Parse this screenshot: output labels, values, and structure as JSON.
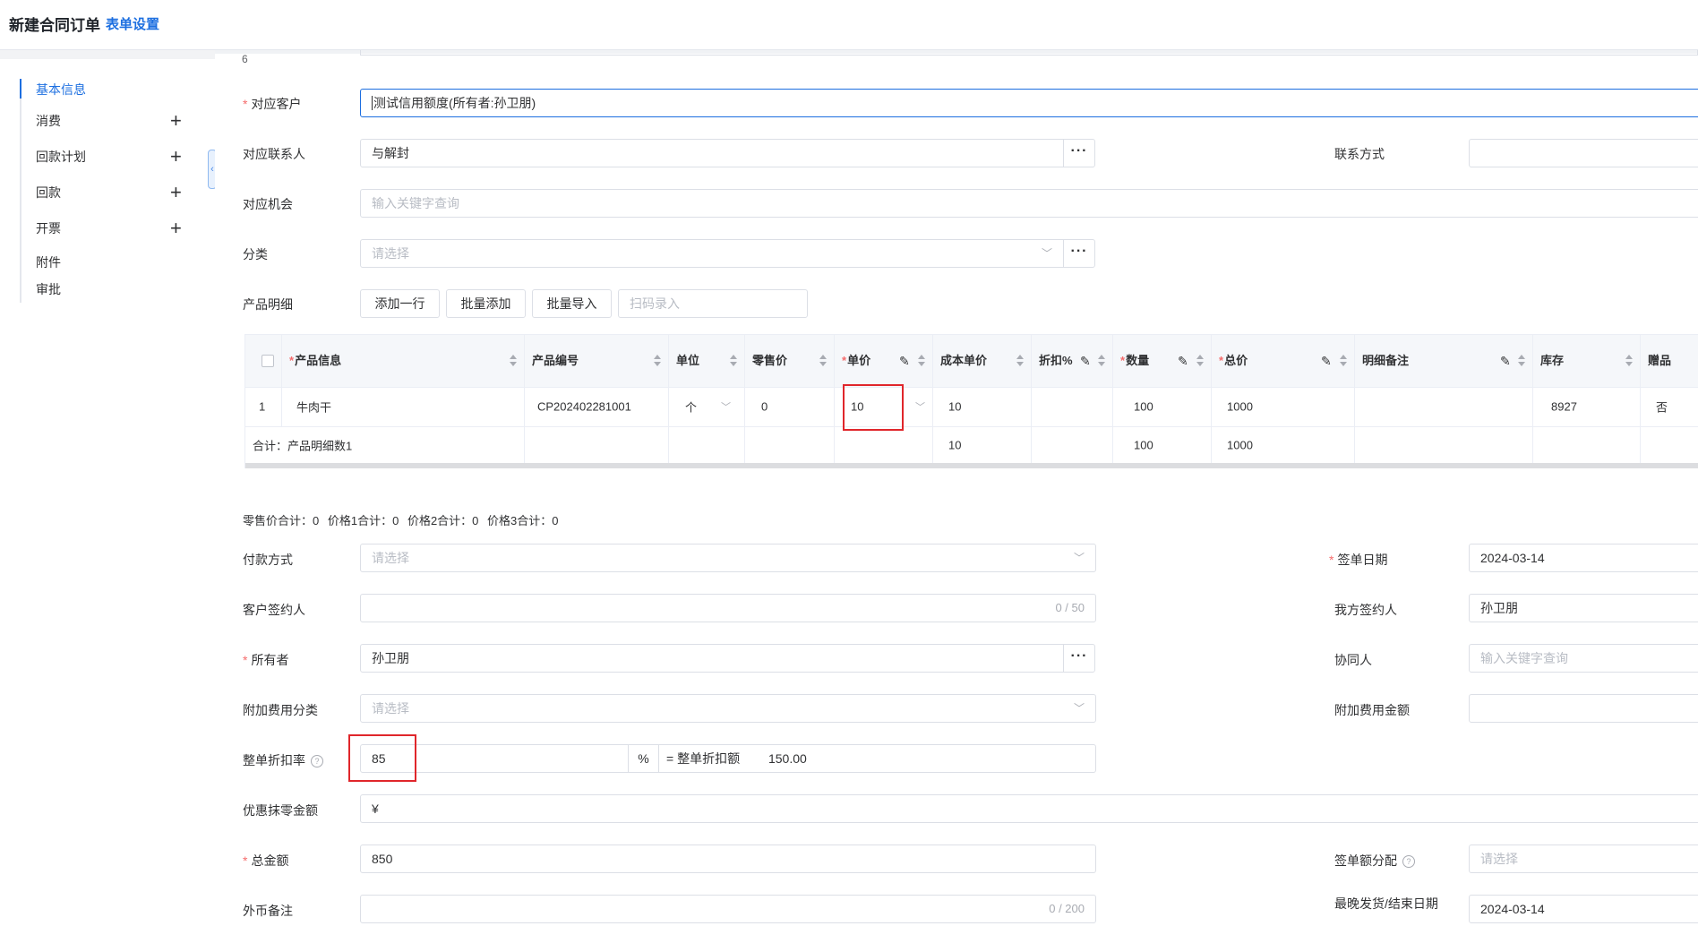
{
  "header": {
    "title": "新建合同订单",
    "settings_link": "表单设置"
  },
  "sidebar": {
    "items": [
      {
        "label": "基本信息",
        "active": true,
        "expandable": false
      },
      {
        "label": "消费",
        "expandable": true
      },
      {
        "label": "回款计划",
        "expandable": true
      },
      {
        "label": "回款",
        "expandable": true
      },
      {
        "label": "开票",
        "expandable": true
      },
      {
        "label": "附件",
        "expandable": false
      },
      {
        "label": "审批",
        "expandable": false
      }
    ],
    "plus_icon": "+"
  },
  "form": {
    "cut_label": "6",
    "customer": {
      "label": "对应客户",
      "value": "测试信用额度(所有者:孙卫朋)"
    },
    "contact": {
      "label": "对应联系人",
      "value": "与解封"
    },
    "contact_method": {
      "label": "联系方式",
      "value": ""
    },
    "opportunity": {
      "label": "对应机会",
      "placeholder": "输入关键字查询"
    },
    "category": {
      "label": "分类",
      "placeholder": "请选择"
    },
    "product_detail": {
      "label": "产品明细",
      "add_row": "添加一行",
      "batch_add": "批量添加",
      "batch_import": "批量导入",
      "scan_placeholder": "扫码录入"
    },
    "payment_method": {
      "label": "付款方式",
      "placeholder": "请选择"
    },
    "sign_date": {
      "label": "签单日期",
      "value": "2024-03-14"
    },
    "customer_signer": {
      "label": "客户签约人",
      "value": "",
      "count": "0 / 50"
    },
    "our_signer": {
      "label": "我方签约人",
      "value": "孙卫朋"
    },
    "owner": {
      "label": "所有者",
      "value": "孙卫朋"
    },
    "collaborator": {
      "label": "协同人",
      "placeholder": "输入关键字查询"
    },
    "extra_fee_category": {
      "label": "附加费用分类",
      "placeholder": "请选择"
    },
    "extra_fee_amount": {
      "label": "附加费用金额",
      "value": ""
    },
    "discount_rate": {
      "label": "整单折扣率",
      "value": "85",
      "unit": "%",
      "eq_label": "= 整单折扣额",
      "discount_amount": "150.00"
    },
    "rounding": {
      "label": "优惠抹零金额",
      "prefix": "¥",
      "value": ""
    },
    "total": {
      "label": "总金额",
      "value": "850"
    },
    "sign_amount_alloc": {
      "label": "签单额分配",
      "placeholder": "请选择"
    },
    "fx_note": {
      "label": "外币备注",
      "value": "",
      "count": "0 / 200"
    },
    "latest_ship": {
      "label": "最晚发货/结束日期",
      "value": "2024-03-14"
    }
  },
  "table": {
    "columns": [
      {
        "label": "产品信息",
        "required": true,
        "pen": false
      },
      {
        "label": "产品编号",
        "required": false,
        "pen": false
      },
      {
        "label": "单位",
        "required": false,
        "pen": false
      },
      {
        "label": "零售价",
        "required": false,
        "pen": false
      },
      {
        "label": "单价",
        "required": true,
        "pen": true
      },
      {
        "label": "成本单价",
        "required": false,
        "pen": false
      },
      {
        "label": "折扣%",
        "required": false,
        "pen": true
      },
      {
        "label": "数量",
        "required": true,
        "pen": true
      },
      {
        "label": "总价",
        "required": true,
        "pen": true
      },
      {
        "label": "明细备注",
        "required": false,
        "pen": true
      },
      {
        "label": "库存",
        "required": false,
        "pen": false
      },
      {
        "label": "赠品",
        "required": false,
        "pen": false
      }
    ],
    "rows": [
      {
        "index": "1",
        "product": "牛肉干",
        "code": "CP202402281001",
        "unit": "个",
        "retail": "0",
        "price": "10",
        "cost": "10",
        "discount": "",
        "qty": "100",
        "total": "1000",
        "note": "",
        "stock": "8927",
        "gift": "否"
      }
    ],
    "footer": {
      "label": "合计：产品明细数1",
      "cost": "10",
      "qty": "100",
      "total": "1000"
    }
  },
  "summary": {
    "retail_total": "零售价合计：0",
    "price1_total": "价格1合计：0",
    "price2_total": "价格2合计：0",
    "price3_total": "价格3合计：0"
  },
  "colors": {
    "accent": "#1d6fe0",
    "required": "#f56c6c",
    "highlight_box": "#e0262b"
  }
}
